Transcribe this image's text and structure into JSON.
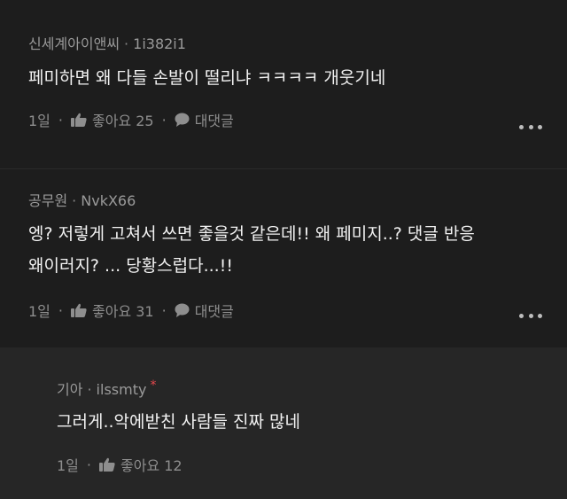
{
  "comments": [
    {
      "nickname": "신세계아이앤씨",
      "user_id": "1i382i1",
      "text_lines": [
        "페미하면 왜 다들 손발이 떨리냐 ㅋㅋㅋㅋ 개웃기네"
      ],
      "time": "1일",
      "like_label": "좋아요 25",
      "reply_label": "대댓글"
    },
    {
      "nickname": "공무원",
      "user_id": "NvkX66",
      "text_lines": [
        "엥? 저렇게 고쳐서 쓰면 좋을것 같은데!! 왜 페미지..? 댓글 반응",
        "왜이러지? ... 당황스럽다...!!"
      ],
      "time": "1일",
      "like_label": "좋아요 31",
      "reply_label": "대댓글"
    }
  ],
  "reply": {
    "nickname": "기아",
    "user_id": "ilssmty",
    "marker": "*",
    "text_lines": [
      "그러게..악에받친 사람들 진짜 많네"
    ],
    "time": "1일",
    "like_label": "좋아요 12"
  },
  "separator": "·",
  "colors": {
    "background": "#1d1d1d",
    "reply_background": "#262626",
    "text": "#f2f2f2",
    "meta": "#9a9a9a",
    "marker": "#e5484d"
  },
  "icons": [
    "thumbs-up-icon",
    "speech-bubble-icon",
    "more-options-icon"
  ]
}
